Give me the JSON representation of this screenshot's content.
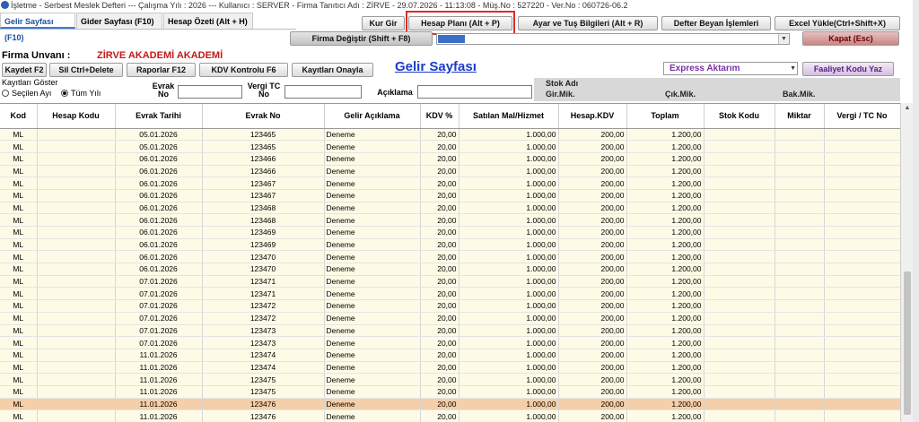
{
  "window": {
    "title": "İşletme - Serbest Meslek Defteri  ---  Çalışma Yılı : 2026  ---  Kullanıcı : SERVER - Firma Tanıtıcı Adı : ZİRVE - 29.07.2026 - 11:13:08 - Müş.No : 527220 - Ver.No : 060726-06.2"
  },
  "tabs": [
    {
      "label": "Gelir Sayfası (F10)"
    },
    {
      "label": "Gider Sayfası (F10)"
    },
    {
      "label": "Hesap Özeti (Alt + H)"
    }
  ],
  "toolbar": {
    "kur_gir": "Kur Gir",
    "hesap_plani": "Hesap Planı (Alt + P)",
    "ayar_tus": "Ayar ve Tuş Bilgileri (Alt + R)",
    "defter_beyan": "Defter Beyan İşlemleri",
    "excel_yukle": "Excel Yükle(Ctrl+Shift+X)",
    "firma_degistir": "Firma Değiştir (Shift + F8)",
    "kapat": "Kapat (Esc)"
  },
  "firma": {
    "label": "Firma Unvanı :",
    "value": "ZİRVE AKADEMİ AKADEMİ"
  },
  "actions": {
    "kaydet": "Kaydet F2",
    "sil": "Sil Ctrl+Delete",
    "raporlar": "Raporlar F12",
    "kdv_kontrolu": "KDV Kontrolu F6",
    "kayitlari_onayla": "Kayıtları Onayla"
  },
  "page_title": "Gelir Sayfası",
  "express": {
    "value": "Express Aktarım"
  },
  "faaliyet_button": "Faaliyet Kodu Yaz",
  "filter": {
    "title": "Kayıtları Göster",
    "option_secilen": "Seçilen Ayı",
    "option_tum": "Tüm Yılı",
    "evrak_no_label_1": "Evrak",
    "evrak_no_label_2": "No",
    "vergi_label_1": "Vergi TC",
    "vergi_label_2": "No",
    "aciklama_label": "Açıklama"
  },
  "stok": {
    "title": "Stok Adı",
    "gir": "Gir.Mik.",
    "cik": "Çık.Mik.",
    "bak": "Bak.Mik."
  },
  "columns": [
    "Kod",
    "Hesap Kodu",
    "Evrak Tarihi",
    "Evrak No",
    "Gelir Açıklama",
    "KDV %",
    "Satılan Mal/Hizmet",
    "Hesap.KDV",
    "Toplam",
    "Stok Kodu",
    "Miktar",
    "Vergi / TC No"
  ],
  "rows": [
    [
      "ML",
      "",
      "05.01.2026",
      "123465",
      "Deneme",
      "20,00",
      "1.000,00",
      "200,00",
      "1.200,00",
      "",
      "",
      ""
    ],
    [
      "ML",
      "",
      "05.01.2026",
      "123465",
      "Deneme",
      "20,00",
      "1.000,00",
      "200,00",
      "1.200,00",
      "",
      "",
      ""
    ],
    [
      "ML",
      "",
      "06.01.2026",
      "123466",
      "Deneme",
      "20,00",
      "1.000,00",
      "200,00",
      "1.200,00",
      "",
      "",
      ""
    ],
    [
      "ML",
      "",
      "06.01.2026",
      "123466",
      "Deneme",
      "20,00",
      "1.000,00",
      "200,00",
      "1.200,00",
      "",
      "",
      ""
    ],
    [
      "ML",
      "",
      "06.01.2026",
      "123467",
      "Deneme",
      "20,00",
      "1.000,00",
      "200,00",
      "1.200,00",
      "",
      "",
      ""
    ],
    [
      "ML",
      "",
      "06.01.2026",
      "123467",
      "Deneme",
      "20,00",
      "1.000,00",
      "200,00",
      "1.200,00",
      "",
      "",
      ""
    ],
    [
      "ML",
      "",
      "06.01.2026",
      "123468",
      "Deneme",
      "20,00",
      "1.000,00",
      "200,00",
      "1.200,00",
      "",
      "",
      ""
    ],
    [
      "ML",
      "",
      "06.01.2026",
      "123468",
      "Deneme",
      "20,00",
      "1.000,00",
      "200,00",
      "1.200,00",
      "",
      "",
      ""
    ],
    [
      "ML",
      "",
      "06.01.2026",
      "123469",
      "Deneme",
      "20,00",
      "1.000,00",
      "200,00",
      "1.200,00",
      "",
      "",
      ""
    ],
    [
      "ML",
      "",
      "06.01.2026",
      "123469",
      "Deneme",
      "20,00",
      "1.000,00",
      "200,00",
      "1.200,00",
      "",
      "",
      ""
    ],
    [
      "ML",
      "",
      "06.01.2026",
      "123470",
      "Deneme",
      "20,00",
      "1.000,00",
      "200,00",
      "1.200,00",
      "",
      "",
      ""
    ],
    [
      "ML",
      "",
      "06.01.2026",
      "123470",
      "Deneme",
      "20,00",
      "1.000,00",
      "200,00",
      "1.200,00",
      "",
      "",
      ""
    ],
    [
      "ML",
      "",
      "07.01.2026",
      "123471",
      "Deneme",
      "20,00",
      "1.000,00",
      "200,00",
      "1.200,00",
      "",
      "",
      ""
    ],
    [
      "ML",
      "",
      "07.01.2026",
      "123471",
      "Deneme",
      "20,00",
      "1.000,00",
      "200,00",
      "1.200,00",
      "",
      "",
      ""
    ],
    [
      "ML",
      "",
      "07.01.2026",
      "123472",
      "Deneme",
      "20,00",
      "1.000,00",
      "200,00",
      "1.200,00",
      "",
      "",
      ""
    ],
    [
      "ML",
      "",
      "07.01.2026",
      "123472",
      "Deneme",
      "20,00",
      "1.000,00",
      "200,00",
      "1.200,00",
      "",
      "",
      ""
    ],
    [
      "ML",
      "",
      "07.01.2026",
      "123473",
      "Deneme",
      "20,00",
      "1.000,00",
      "200,00",
      "1.200,00",
      "",
      "",
      ""
    ],
    [
      "ML",
      "",
      "07.01.2026",
      "123473",
      "Deneme",
      "20,00",
      "1.000,00",
      "200,00",
      "1.200,00",
      "",
      "",
      ""
    ],
    [
      "ML",
      "",
      "11.01.2026",
      "123474",
      "Deneme",
      "20,00",
      "1.000,00",
      "200,00",
      "1.200,00",
      "",
      "",
      ""
    ],
    [
      "ML",
      "",
      "11.01.2026",
      "123474",
      "Deneme",
      "20,00",
      "1.000,00",
      "200,00",
      "1.200,00",
      "",
      "",
      ""
    ],
    [
      "ML",
      "",
      "11.01.2026",
      "123475",
      "Deneme",
      "20,00",
      "1.000,00",
      "200,00",
      "1.200,00",
      "",
      "",
      ""
    ],
    [
      "ML",
      "",
      "11.01.2026",
      "123475",
      "Deneme",
      "20,00",
      "1.000,00",
      "200,00",
      "1.200,00",
      "",
      "",
      ""
    ],
    [
      "ML",
      "",
      "11.01.2026",
      "123476",
      "Deneme",
      "20,00",
      "1.000,00",
      "200,00",
      "1.200,00",
      "",
      "",
      ""
    ],
    [
      "ML",
      "",
      "11.01.2026",
      "123476",
      "Deneme",
      "20,00",
      "1.000,00",
      "200,00",
      "1.200,00",
      "",
      "",
      ""
    ]
  ],
  "selected_row_index": 22,
  "colors": {
    "row_bg": "#fdfbe6",
    "selected_row_bg": "#f5cfa9",
    "title_blue": "#1a3cc9",
    "firma_red": "#c21a1a",
    "highlight_red": "#e12a2a"
  }
}
